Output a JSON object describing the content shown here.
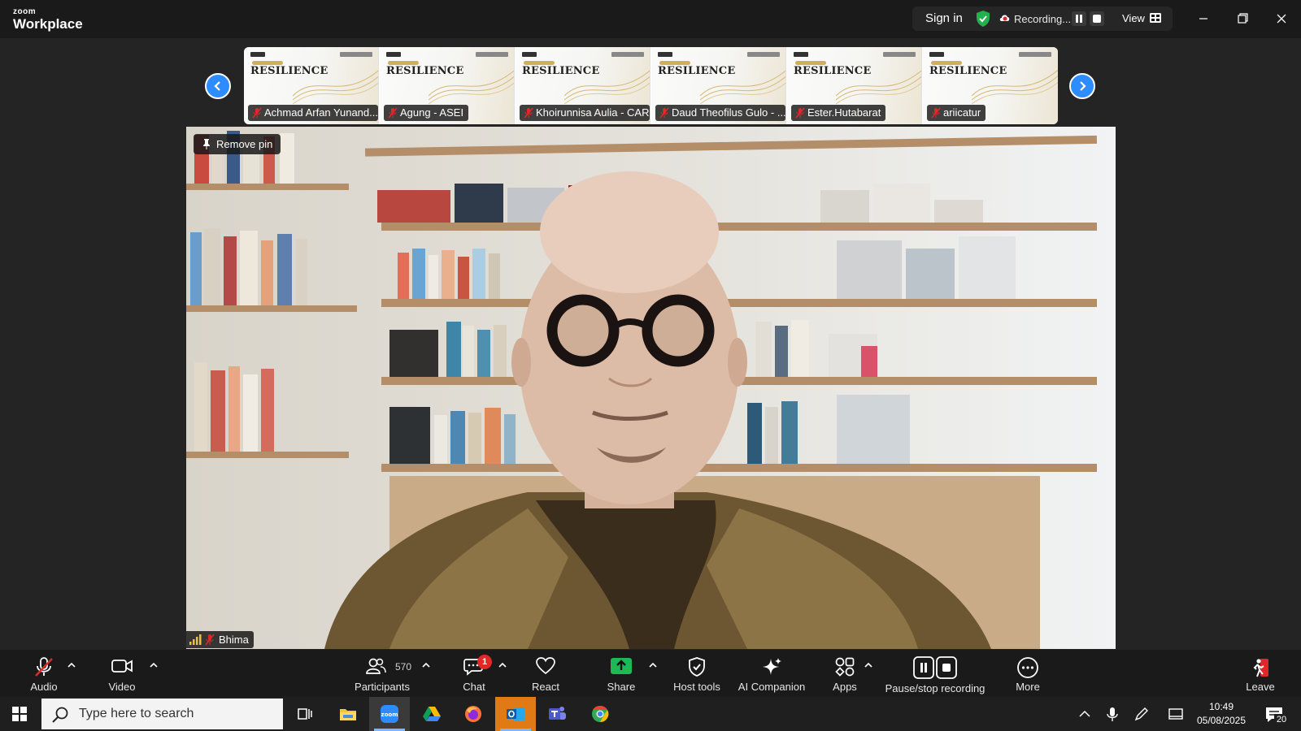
{
  "app": {
    "logo_top": "zoom",
    "logo_bottom": "Workplace"
  },
  "titlebar": {
    "sign_in": "Sign in",
    "recording_label": "Recording...",
    "view_label": "View"
  },
  "thumbnails": [
    {
      "name": "Achmad Arfan Yunand...",
      "slide_title": "RESILIENCE"
    },
    {
      "name": "Agung - ASEI",
      "slide_title": "RESILIENCE"
    },
    {
      "name": "Khoirunnisa Aulia - CAR",
      "slide_title": "RESILIENCE"
    },
    {
      "name": "Daud Theofilus Gulo - ...",
      "slide_title": "RESILIENCE"
    },
    {
      "name": "Ester.Hutabarat",
      "slide_title": "RESILIENCE"
    },
    {
      "name": "ariicatur",
      "slide_title": "RESILIENCE"
    }
  ],
  "main_video": {
    "pin_label": "Remove pin",
    "speaker_name": "Bhima"
  },
  "toolbar": {
    "audio": "Audio",
    "video": "Video",
    "participants": "Participants",
    "participants_count": "570",
    "chat": "Chat",
    "chat_badge": "1",
    "react": "React",
    "share": "Share",
    "host_tools": "Host tools",
    "ai_companion": "AI Companion",
    "apps": "Apps",
    "pause_stop_recording": "Pause/stop recording",
    "more": "More",
    "leave": "Leave"
  },
  "taskbar": {
    "search_placeholder": "Type here to search",
    "time": "10:49",
    "date": "05/08/2025",
    "notification_count": "20"
  },
  "colors": {
    "accent_blue": "#2d8cff",
    "share_green": "#1db954",
    "muted_red": "#e02828",
    "shield_green": "#22b14c"
  }
}
